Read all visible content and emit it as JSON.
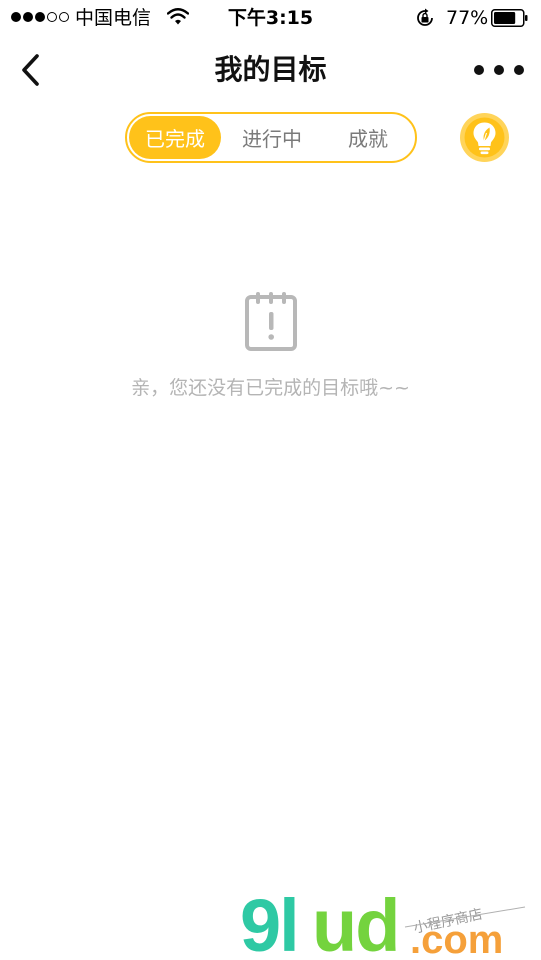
{
  "status_bar": {
    "carrier": "中国电信",
    "time": "下午3:15",
    "battery_percent": "77%",
    "battery_level": 0.77,
    "signal_bars_filled": 3,
    "signal_bars_total": 5
  },
  "nav": {
    "title": "我的目标",
    "back_icon": "chevron-left-icon",
    "more_icon": "more-dots-icon"
  },
  "tabs": [
    {
      "label": "已完成",
      "active": true
    },
    {
      "label": "进行中",
      "active": false
    },
    {
      "label": "成就",
      "active": false
    }
  ],
  "bulb_icon": "lightbulb-icon",
  "empty_state": {
    "icon": "calendar-alert-icon",
    "message": "亲，您还没有已完成的目标哦~~"
  },
  "watermark": {
    "brand": "9lud",
    "domain": ".com",
    "tagline": "小程序商店"
  },
  "colors": {
    "accent": "#FFC21A",
    "muted_text": "#b4b4b4",
    "tab_inactive": "#7a7a7a",
    "icon_gray": "#b8b8b8"
  }
}
